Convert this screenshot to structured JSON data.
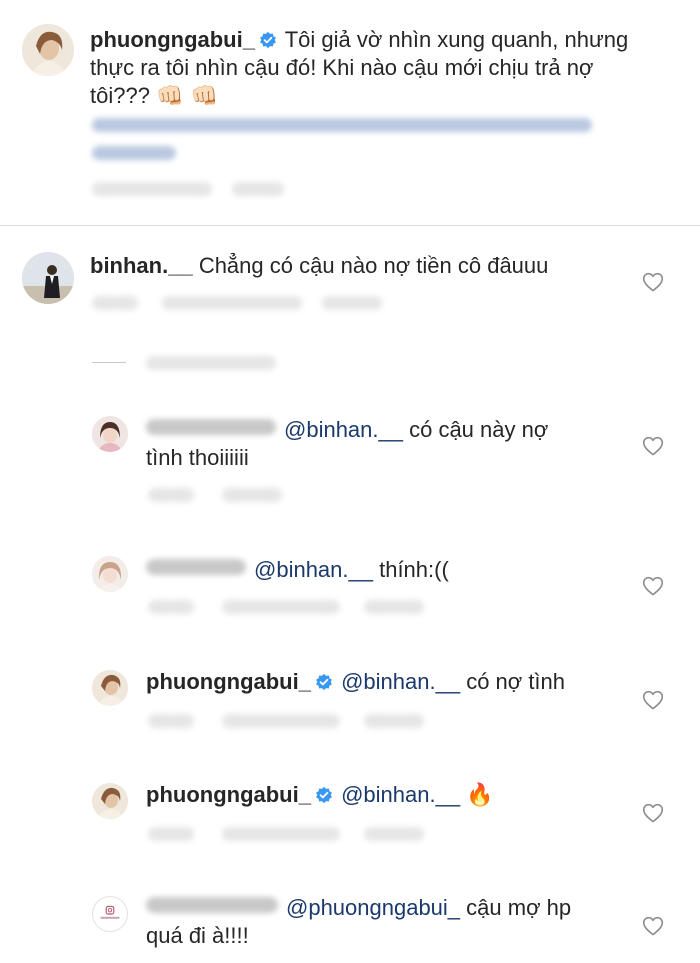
{
  "caption": {
    "username": "phuongngabui_",
    "text": "Tôi giả vờ nhìn xung quanh, nhưng thực ra tôi nhìn cậu đó! Khi nào cậu mới chịu trả nợ tôi??? 👊🏻👊🏻",
    "line1": "Tôi giả vờ nhìn xung quanh, nhưng",
    "line2": "thực ra tôi nhìn cậu đó! Khi nào cậu mới chịu trả nợ",
    "line3": "tôi???",
    "emoji": "👊🏻 👊🏻"
  },
  "comments": [
    {
      "username": "binhan.__",
      "text": "Chẳng có cậu nào nợ tiền cô đâuuu"
    }
  ],
  "replies": [
    {
      "mention": "@binhan.__",
      "text_line1": " có cậu này nợ",
      "text_line2": "tình thoiiiiii"
    },
    {
      "mention": "@binhan.__",
      "text": " thính:(("
    },
    {
      "username": "phuongngabui_",
      "mention": "@binhan.__",
      "text": " có nợ tình"
    },
    {
      "username": "phuongngabui_",
      "mention": "@binhan.__",
      "emoji": "🔥"
    },
    {
      "mention": "@phuongngabui_",
      "text_line1": " cậu mợ hp",
      "text_line2": "quá đi à!!!!"
    }
  ],
  "icons": {
    "verified": "verified-badge-icon",
    "heart": "heart-outline-icon"
  },
  "colors": {
    "text": "#262626",
    "mention": "#1b3a6b",
    "verified": "#3897f0",
    "divider": "#dbdbdb",
    "heart": "#8e8e8e"
  }
}
